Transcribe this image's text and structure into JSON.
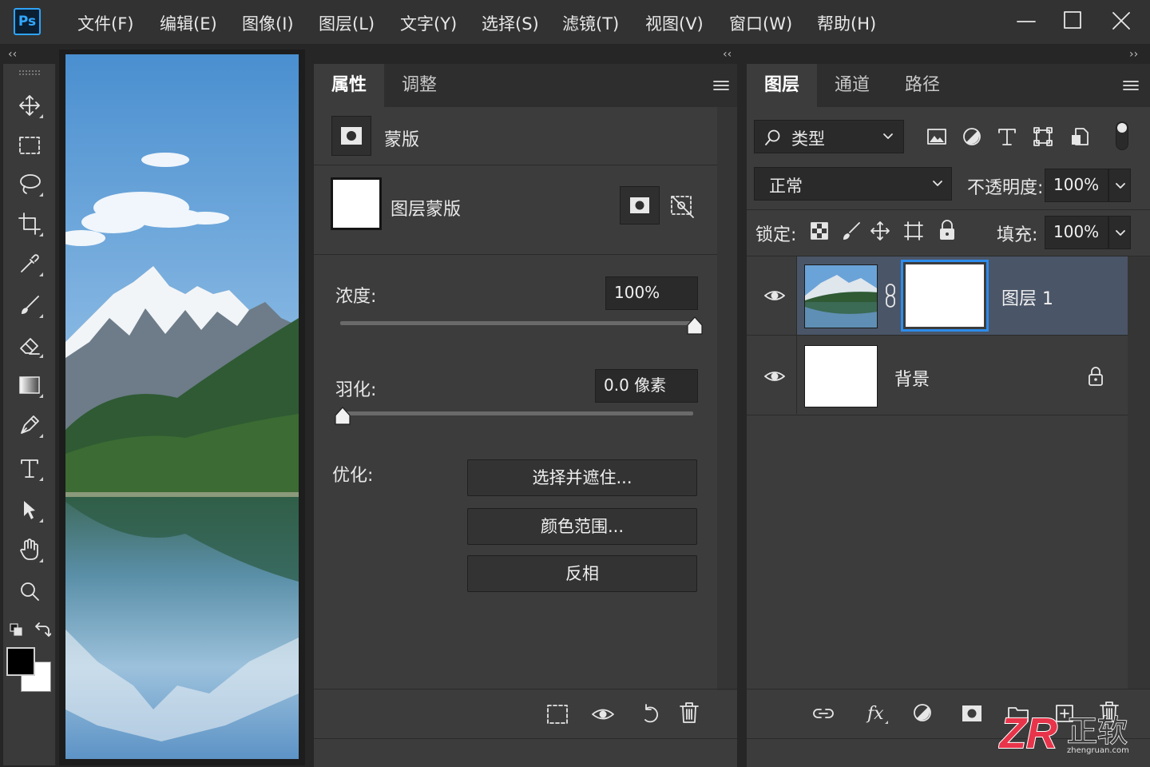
{
  "app": {
    "logo": "Ps"
  },
  "menu": [
    "文件(F)",
    "编辑(E)",
    "图像(I)",
    "图层(L)",
    "文字(Y)",
    "选择(S)",
    "滤镜(T)",
    "视图(V)",
    "窗口(W)",
    "帮助(H)"
  ],
  "collapse_left": "‹‹",
  "collapse_right": "››",
  "tools": [
    "move-tool-icon",
    "marquee-tool-icon",
    "lasso-tool-icon",
    "crop-tool-icon",
    "eyedropper-tool-icon",
    "brush-tool-icon",
    "eraser-tool-icon",
    "gradient-tool-icon",
    "pen-tool-icon",
    "type-tool-icon",
    "path-select-tool-icon",
    "hand-tool-icon",
    "zoom-tool-icon"
  ],
  "properties": {
    "tabs": [
      "属性",
      "调整"
    ],
    "section_title": "蒙版",
    "layer_mask_label": "图层蒙版",
    "density_label": "浓度:",
    "density_value": "100%",
    "density_fraction": 1.0,
    "feather_label": "羽化:",
    "feather_value": "0.0 像素",
    "feather_fraction": 0.0,
    "refine_label": "优化:",
    "buttons": [
      "选择并遮住...",
      "颜色范围...",
      "反相"
    ]
  },
  "layers": {
    "tabs": [
      "图层",
      "通道",
      "路径"
    ],
    "filter_kind": "类型",
    "blend_mode": "正常",
    "opacity_label": "不透明度:",
    "opacity_value": "100%",
    "lock_label": "锁定:",
    "fill_label": "填充:",
    "fill_value": "100%",
    "items": [
      {
        "name": "图层 1",
        "selected": true,
        "has_mask": true
      },
      {
        "name": "背景",
        "selected": false,
        "locked": true
      }
    ]
  },
  "colors": {
    "accent": "#2d8ceb",
    "selected_row": "#4a5567",
    "panel_bg": "#3c3c3c"
  },
  "watermark": {
    "brand": "ZR",
    "text": "正软",
    "url": "zhengruan.com"
  }
}
